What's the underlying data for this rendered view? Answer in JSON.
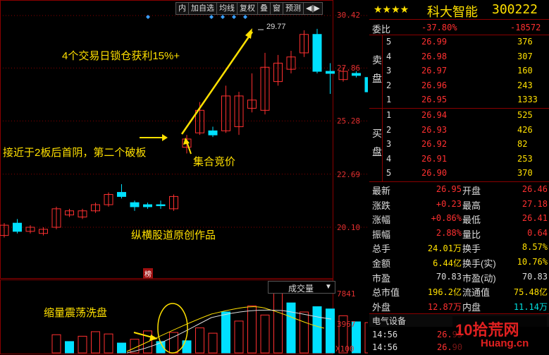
{
  "toolbar": {
    "items": [
      "内",
      "加自选",
      "均线",
      "复权",
      "叠",
      "窗",
      "预测",
      "◀|▶"
    ]
  },
  "price_axis": [
    "30.42",
    "27.86",
    "25.28",
    "22.69",
    "20.10"
  ],
  "peak_label": "29.77",
  "volume_axis": [
    "7841",
    "3967",
    "X100"
  ],
  "volume_tab": "成交量",
  "annotations": {
    "gain": "4个交易日锁仓获利15%+",
    "near_board": "接近于2板后首阴，第二个破板",
    "auction": "集合竞价",
    "watermark": "纵横股道原创作品",
    "volume_note": "缩量震荡洗盘",
    "rank_badge": "榜"
  },
  "stock": {
    "stars": "★★★★",
    "name": "科大智能",
    "code": "300222"
  },
  "order_book": {
    "ratio_label": "委比",
    "ratio_value": "-37.80%",
    "diff_value": "-18572",
    "sell_label": "卖盘",
    "buy_label": "买盘",
    "sell": [
      {
        "level": "5",
        "price": "26.99",
        "vol": "376"
      },
      {
        "level": "4",
        "price": "26.98",
        "vol": "307"
      },
      {
        "level": "3",
        "price": "26.97",
        "vol": "160"
      },
      {
        "level": "2",
        "price": "26.96",
        "vol": "243"
      },
      {
        "level": "1",
        "price": "26.95",
        "vol": "1333"
      }
    ],
    "buy": [
      {
        "level": "1",
        "price": "26.94",
        "vol": "525"
      },
      {
        "level": "2",
        "price": "26.93",
        "vol": "426"
      },
      {
        "level": "3",
        "price": "26.92",
        "vol": "82"
      },
      {
        "level": "4",
        "price": "26.91",
        "vol": "253"
      },
      {
        "level": "5",
        "price": "26.90",
        "vol": "370"
      }
    ]
  },
  "quote": [
    {
      "l1": "最新",
      "v1": "26.95",
      "c1": "red",
      "l2": "开盘",
      "v2": "26.46",
      "c2": "red"
    },
    {
      "l1": "涨跌",
      "v1": "+0.23",
      "c1": "red",
      "l2": "最高",
      "v2": "27.18",
      "c2": "red"
    },
    {
      "l1": "涨幅",
      "v1": "+0.86%",
      "c1": "red",
      "l2": "最低",
      "v2": "26.41",
      "c2": "red"
    },
    {
      "l1": "振幅",
      "v1": "2.88%",
      "c1": "red",
      "l2": "量比",
      "v2": "0.64",
      "c2": "red"
    },
    {
      "l1": "总手",
      "v1": "24.01万",
      "c1": "yellow",
      "l2": "换手",
      "v2": "8.57%",
      "c2": "yellow"
    },
    {
      "l1": "金额",
      "v1": "6.44亿",
      "c1": "yellow",
      "l2": "换手(实)",
      "v2": "10.76%",
      "c2": "yellow"
    },
    {
      "l1": "市盈",
      "v1": "70.83",
      "c1": "white",
      "l2": "市盈(动)",
      "v2": "70.83",
      "c2": "white"
    },
    {
      "l1": "总市值",
      "v1": "196.2亿",
      "c1": "yellow",
      "l2": "流通值",
      "v2": "75.48亿",
      "c2": "yellow"
    },
    {
      "l1": "外盘",
      "v1": "12.87万",
      "c1": "red",
      "l2": "内盘",
      "v2": "11.14万",
      "c2": "cyan"
    }
  ],
  "sector": "电气设备",
  "ticks": [
    {
      "time": "14:56",
      "price": "26.95"
    },
    {
      "time": "14:56",
      "price": "26.90"
    }
  ],
  "brand": "10拾荒网",
  "brand_url": "Huang.cn",
  "chart_data": {
    "type": "candlestick",
    "price_ticks": [
      30.42,
      27.86,
      25.28,
      22.69,
      20.1
    ],
    "candles": [
      {
        "o": 19.7,
        "c": 20.2,
        "h": 20.3,
        "l": 19.6,
        "up": true
      },
      {
        "o": 20.3,
        "c": 19.9,
        "h": 20.5,
        "l": 19.8,
        "up": false
      },
      {
        "o": 19.9,
        "c": 20.1,
        "h": 20.2,
        "l": 19.8,
        "up": true
      },
      {
        "o": 20.0,
        "c": 19.8,
        "h": 20.1,
        "l": 19.7,
        "up": true
      },
      {
        "o": 20.1,
        "c": 21.0,
        "h": 21.1,
        "l": 20.0,
        "up": true
      },
      {
        "o": 20.9,
        "c": 20.7,
        "h": 21.0,
        "l": 20.6,
        "up": true
      },
      {
        "o": 20.6,
        "c": 20.9,
        "h": 21.0,
        "l": 20.5,
        "up": true
      },
      {
        "o": 20.9,
        "c": 21.2,
        "h": 21.3,
        "l": 20.8,
        "up": true
      },
      {
        "o": 21.2,
        "c": 21.7,
        "h": 21.8,
        "l": 21.1,
        "up": true
      },
      {
        "o": 21.8,
        "c": 21.6,
        "h": 22.2,
        "l": 21.5,
        "up": false
      },
      {
        "o": 21.3,
        "c": 21.1,
        "h": 21.4,
        "l": 20.9,
        "up": false
      },
      {
        "o": 21.2,
        "c": 21.1,
        "h": 21.3,
        "l": 21.0,
        "up": false
      },
      {
        "o": 21.2,
        "c": 21.2,
        "h": 21.4,
        "l": 21.0,
        "up": false
      },
      {
        "o": 21.0,
        "c": 21.6,
        "h": 21.7,
        "l": 20.9,
        "up": true
      },
      {
        "o": 24.0,
        "c": 24.4,
        "h": 24.6,
        "l": 23.7,
        "up": true
      },
      {
        "o": 24.7,
        "c": 25.8,
        "h": 26.2,
        "l": 24.6,
        "up": true
      },
      {
        "o": 24.8,
        "c": 24.6,
        "h": 25.0,
        "l": 24.5,
        "up": false
      },
      {
        "o": 24.8,
        "c": 26.5,
        "h": 27.0,
        "l": 24.7,
        "up": true
      },
      {
        "o": 25.0,
        "c": 26.5,
        "h": 26.7,
        "l": 24.6,
        "up": true
      },
      {
        "o": 25.9,
        "c": 26.3,
        "h": 27.6,
        "l": 25.7,
        "up": true
      },
      {
        "o": 25.8,
        "c": 27.9,
        "h": 28.6,
        "l": 25.6,
        "up": true
      },
      {
        "o": 27.2,
        "c": 28.1,
        "h": 28.5,
        "l": 27.0,
        "up": true
      },
      {
        "o": 27.8,
        "c": 28.4,
        "h": 28.7,
        "l": 27.6,
        "up": true
      },
      {
        "o": 28.6,
        "c": 29.5,
        "h": 29.7,
        "l": 28.4,
        "up": true
      },
      {
        "o": 27.7,
        "c": 29.5,
        "h": 29.77,
        "l": 27.6,
        "up": false
      },
      {
        "o": 27.7,
        "c": 27.6,
        "h": 28.1,
        "l": 26.6,
        "up": false
      },
      {
        "o": 27.3,
        "c": 27.7,
        "h": 27.9,
        "l": 27.2,
        "up": true
      },
      {
        "o": 27.5,
        "c": 27.6,
        "h": 27.7,
        "l": 27.4,
        "up": false
      },
      {
        "o": 27.4,
        "c": 26.7,
        "h": 27.5,
        "l": 26.3,
        "up": false
      },
      {
        "o": 26.5,
        "c": 26.9,
        "h": 27.2,
        "l": 26.4,
        "up": true
      }
    ],
    "volume_ticks": [
      7841,
      3967
    ],
    "volumes": [
      {
        "v": 2400,
        "up": true
      },
      {
        "v": 1500,
        "up": false
      },
      {
        "v": 2200,
        "up": true
      },
      {
        "v": 2800,
        "up": true
      },
      {
        "v": 2500,
        "up": true
      },
      {
        "v": 1300,
        "up": false
      },
      {
        "v": 1800,
        "up": true
      },
      {
        "v": 2900,
        "up": true
      },
      {
        "v": 1500,
        "up": false
      },
      {
        "v": 2700,
        "up": true
      },
      {
        "v": 1600,
        "up": false
      },
      {
        "v": 3300,
        "up": true
      },
      {
        "v": 2600,
        "up": true
      },
      {
        "v": 5400,
        "up": false
      },
      {
        "v": 4200,
        "up": true
      },
      {
        "v": 6200,
        "up": true
      },
      {
        "v": 5000,
        "up": true
      },
      {
        "v": 7900,
        "up": true
      },
      {
        "v": 6600,
        "up": false
      },
      {
        "v": 5400,
        "up": true
      },
      {
        "v": 6100,
        "up": false
      },
      {
        "v": 5800,
        "up": false
      },
      {
        "v": 4900,
        "up": true
      },
      {
        "v": 4100,
        "up": false
      },
      {
        "v": 4000,
        "up": true
      }
    ]
  }
}
